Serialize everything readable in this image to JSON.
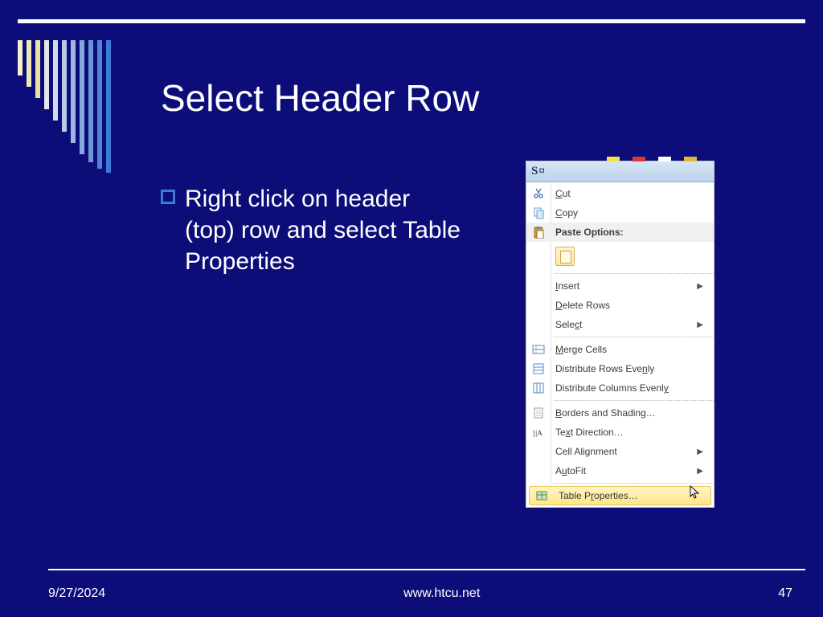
{
  "slide": {
    "title": "Select Header Row",
    "bullet": "Right click on header (top) row and select Table Properties"
  },
  "footer": {
    "date": "9/27/2024",
    "url": "www.htcu.net",
    "page": "47"
  },
  "context_menu": {
    "header_text": "S¤",
    "items": {
      "cut": "Cut",
      "copy": "Copy",
      "paste_options": "Paste Options:",
      "insert": "Insert",
      "delete_rows": "Delete Rows",
      "select": "Select",
      "merge_cells": "Merge Cells",
      "dist_rows": "Distribute Rows Evenly",
      "dist_cols": "Distribute Columns Evenly",
      "borders_shading": "Borders and Shading…",
      "text_direction": "Text Direction…",
      "cell_alignment": "Cell Alignment",
      "autofit": "AutoFit",
      "table_properties": "Table Properties…"
    }
  },
  "decor": {
    "vline_colors": [
      "#f5f0c8",
      "#f0e9b4",
      "#ece2a0",
      "#e6e6e6",
      "#d0daf0",
      "#b8c9e9",
      "#9eb8e3",
      "#84a7dc",
      "#6a96d6",
      "#5085cf",
      "#3b7bd6"
    ],
    "vline_heights": [
      44,
      58,
      72,
      86,
      100,
      114,
      128,
      142,
      152,
      160,
      165
    ],
    "tab_colors": [
      "#f5e24a",
      "#d63a3a",
      "#ffffff",
      "#e8b53a"
    ]
  }
}
